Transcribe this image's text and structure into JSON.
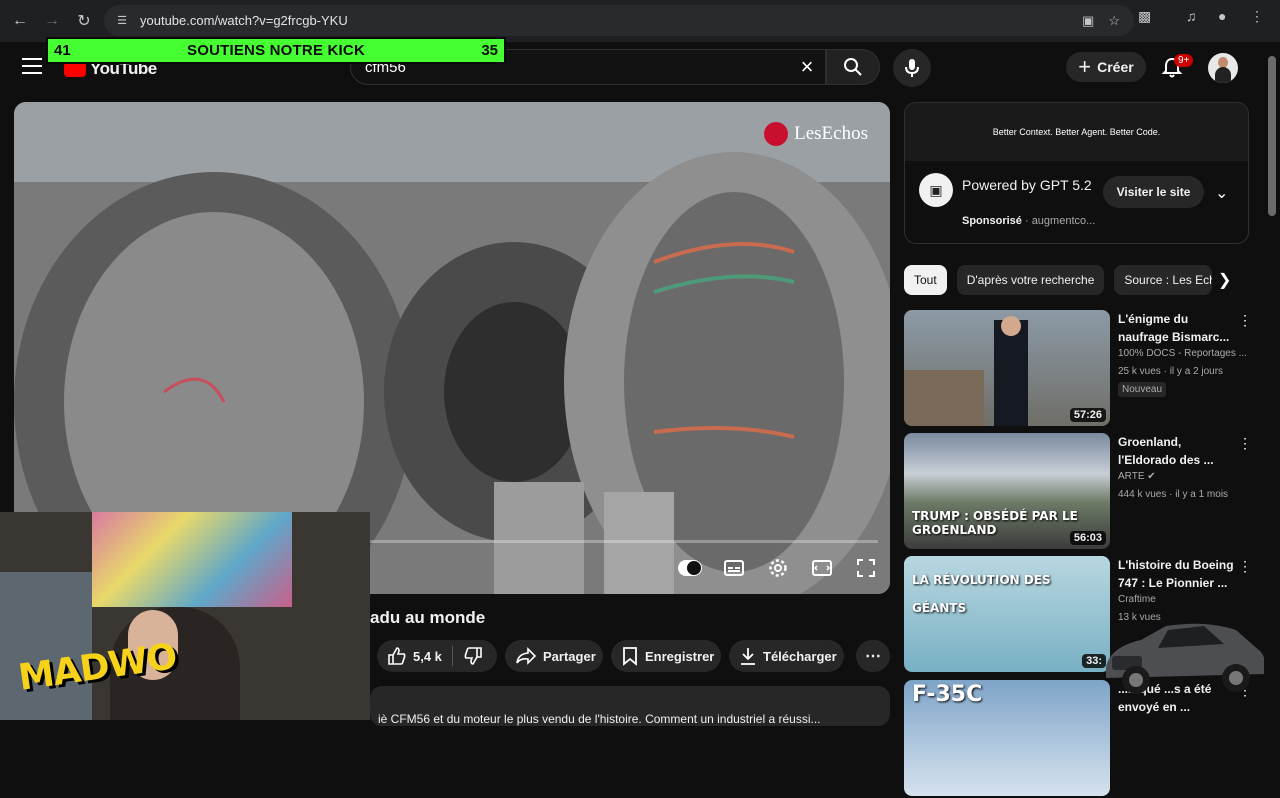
{
  "browser": {
    "url": "youtube.com/watch?v=g2frcgb-YKU"
  },
  "header": {
    "logo": "YouTube",
    "search_value": "cfm56",
    "create_label": "Créer",
    "notif_badge": "9+"
  },
  "overlay": {
    "left": "41",
    "label": "SOUTIENS NOTRE KICK",
    "right": "35",
    "webcam_text": "MADWO"
  },
  "video": {
    "watermark": "LesEchos",
    "title": "adu au monde",
    "like_count": "5,4 k",
    "share_label": "Partager",
    "save_label": "Enregistrer",
    "download_label": "Télécharger",
    "description": "iè CFM56 et du moteur le plus vendu de l'histoire. Comment un industriel a réussi..."
  },
  "ad": {
    "banner": "Better Context. Better Agent. Better Code.",
    "title": "Powered by GPT 5.2",
    "sponsored": "Sponsorisé",
    "advertiser": "augmentco...",
    "visit_label": "Visiter le site"
  },
  "chips": [
    "Tout",
    "D'après votre recherche",
    "Source : Les Echos"
  ],
  "recommendations": [
    {
      "title": "L'énigme du naufrage Bismarc...",
      "channel": "100% DOCS - Reportages ...",
      "meta": "25 k vues · il y a 2 jours",
      "badge": "Nouveau",
      "duration": "57:26",
      "thumb_text": ""
    },
    {
      "title": "Groenland, l'Eldorado des ...",
      "channel": "ARTE",
      "meta": "444 k vues · il y a 1 mois",
      "badge": "",
      "duration": "56:03",
      "thumb_text": "TRUMP : OBSÉDÉ PAR LE GROENLAND"
    },
    {
      "title": "L'histoire du Boeing 747 : Le Pionnier ...",
      "channel": "Craftime",
      "meta": "13 k vues",
      "badge": "",
      "duration": "33:",
      "thumb_text": "LA RÉVOLUTION DES GÉANTS"
    },
    {
      "title": "...arqué ...s a été envoyé en ...",
      "channel": "",
      "meta": "",
      "badge": "",
      "duration": "",
      "thumb_text": "F-35C"
    }
  ]
}
